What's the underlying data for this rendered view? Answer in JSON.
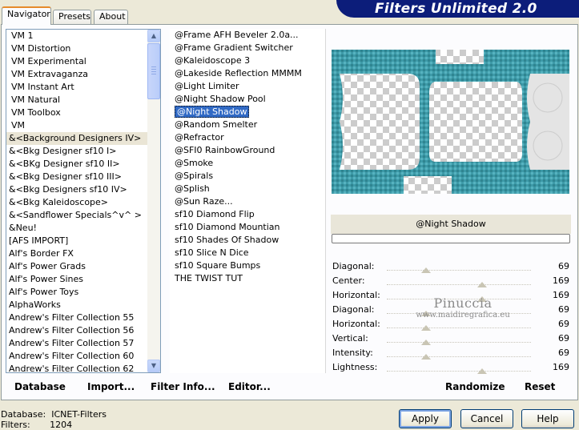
{
  "tabs": [
    {
      "label": "Navigator"
    },
    {
      "label": "Presets"
    },
    {
      "label": "About"
    }
  ],
  "banner": "Filters Unlimited 2.0",
  "categories": [
    "VM 1",
    "VM Distortion",
    "VM Experimental",
    "VM Extravaganza",
    "VM Instant Art",
    "VM Natural",
    "VM Toolbox",
    "VM",
    "&<Background Designers IV>",
    "&<Bkg Designer sf10 I>",
    "&<BKg Designer sf10 II>",
    "&<Bkg Designer sf10 III>",
    "&<Bkg Designers sf10 IV>",
    "&<Bkg Kaleidoscope>",
    "&<Sandflower Specials^v^ >",
    "&Neu!",
    "[AFS IMPORT]",
    "Alf's Border FX",
    "Alf's Power Grads",
    "Alf's Power Sines",
    "Alf's Power Toys",
    "AlphaWorks",
    "Andrew's Filter Collection 55",
    "Andrew's Filter Collection 56",
    "Andrew's Filter Collection 57",
    "Andrew's Filter Collection 60",
    "Andrew's Filter Collection 62"
  ],
  "selected_category": "&<Background Designers IV>",
  "filters": [
    "@Frame AFH Beveler 2.0a...",
    "@Frame Gradient Switcher",
    "@Kaleidoscope 3",
    "@Lakeside Reflection MMMM",
    "@Light Limiter",
    "@Night Shadow Pool",
    "@Night Shadow",
    "@Random Smelter",
    "@Refractor",
    "@SFI0 RainbowGround",
    "@Smoke",
    "@Spirals",
    "@Splish",
    "@Sun Raze...",
    "sf10 Diamond Flip",
    "sf10 Diamond Mountian",
    "sf10 Shades Of Shadow",
    "sf10 Slice N Dice",
    "sf10 Square Bumps",
    "THE TWIST TUT"
  ],
  "selected_filter": "@Night Shadow",
  "filter_name": "@Night Shadow",
  "params": [
    {
      "label": "Diagonal:",
      "value": "69",
      "level": 0.27
    },
    {
      "label": "Center:",
      "value": "169",
      "level": 0.66
    },
    {
      "label": "Horizontal:",
      "value": "169",
      "level": 0.66
    },
    {
      "label": "Diagonal:",
      "value": "69",
      "level": 0.27
    },
    {
      "label": "Horizontal:",
      "value": "69",
      "level": 0.27
    },
    {
      "label": "Vertical:",
      "value": "69",
      "level": 0.27
    },
    {
      "label": "Intensity:",
      "value": "69",
      "level": 0.27
    },
    {
      "label": "Lightness:",
      "value": "169",
      "level": 0.66
    }
  ],
  "watermark": {
    "line1": "Pinuccia",
    "line2": "www.maidiregrafica.eu"
  },
  "bottom_buttons": {
    "database": "Database",
    "import": "Import...",
    "filter_info": "Filter Info...",
    "editor": "Editor...",
    "randomize": "Randomize",
    "reset": "Reset"
  },
  "status": {
    "db_label": "Database:",
    "db_value": "ICNET-Filters",
    "filters_label": "Filters:",
    "filters_value": "1204"
  },
  "dialog_buttons": {
    "apply": "Apply",
    "cancel": "Cancel",
    "help": "Help"
  },
  "colors": {
    "banner": "#0c1d7a",
    "selection": "#316ac5",
    "teal": "#3d9aa8"
  }
}
